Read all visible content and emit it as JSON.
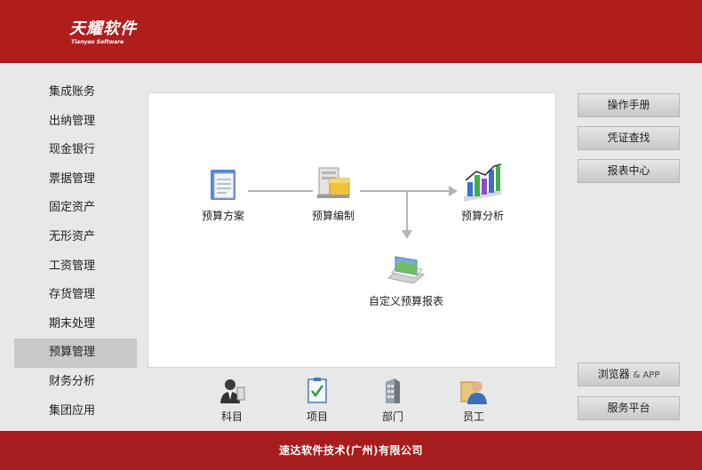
{
  "header": {
    "logo_main": "天耀软件",
    "logo_sub": "Tianyao Software"
  },
  "sidebar": {
    "items": [
      "集成账务",
      "出纳管理",
      "现金银行",
      "票据管理",
      "固定资产",
      "无形资产",
      "工资管理",
      "存货管理",
      "期末处理",
      "预算管理",
      "财务分析",
      "集团应用"
    ],
    "active_index": 9
  },
  "flow": {
    "budget_plan": "预算方案",
    "budget_compile": "预算编制",
    "budget_analysis": "预算分析",
    "custom_report": "自定义预算报表"
  },
  "right_buttons": {
    "manual": "操作手册",
    "voucher_search": "凭证查找",
    "report_center": "报表中心",
    "browser": "浏览器",
    "amp": "& APP",
    "service": "服务平台"
  },
  "bottom_tools": {
    "subject": "科目",
    "project": "项目",
    "department": "部门",
    "employee": "员工"
  },
  "footer": {
    "company": "速达软件技术(广州)有限公司"
  }
}
